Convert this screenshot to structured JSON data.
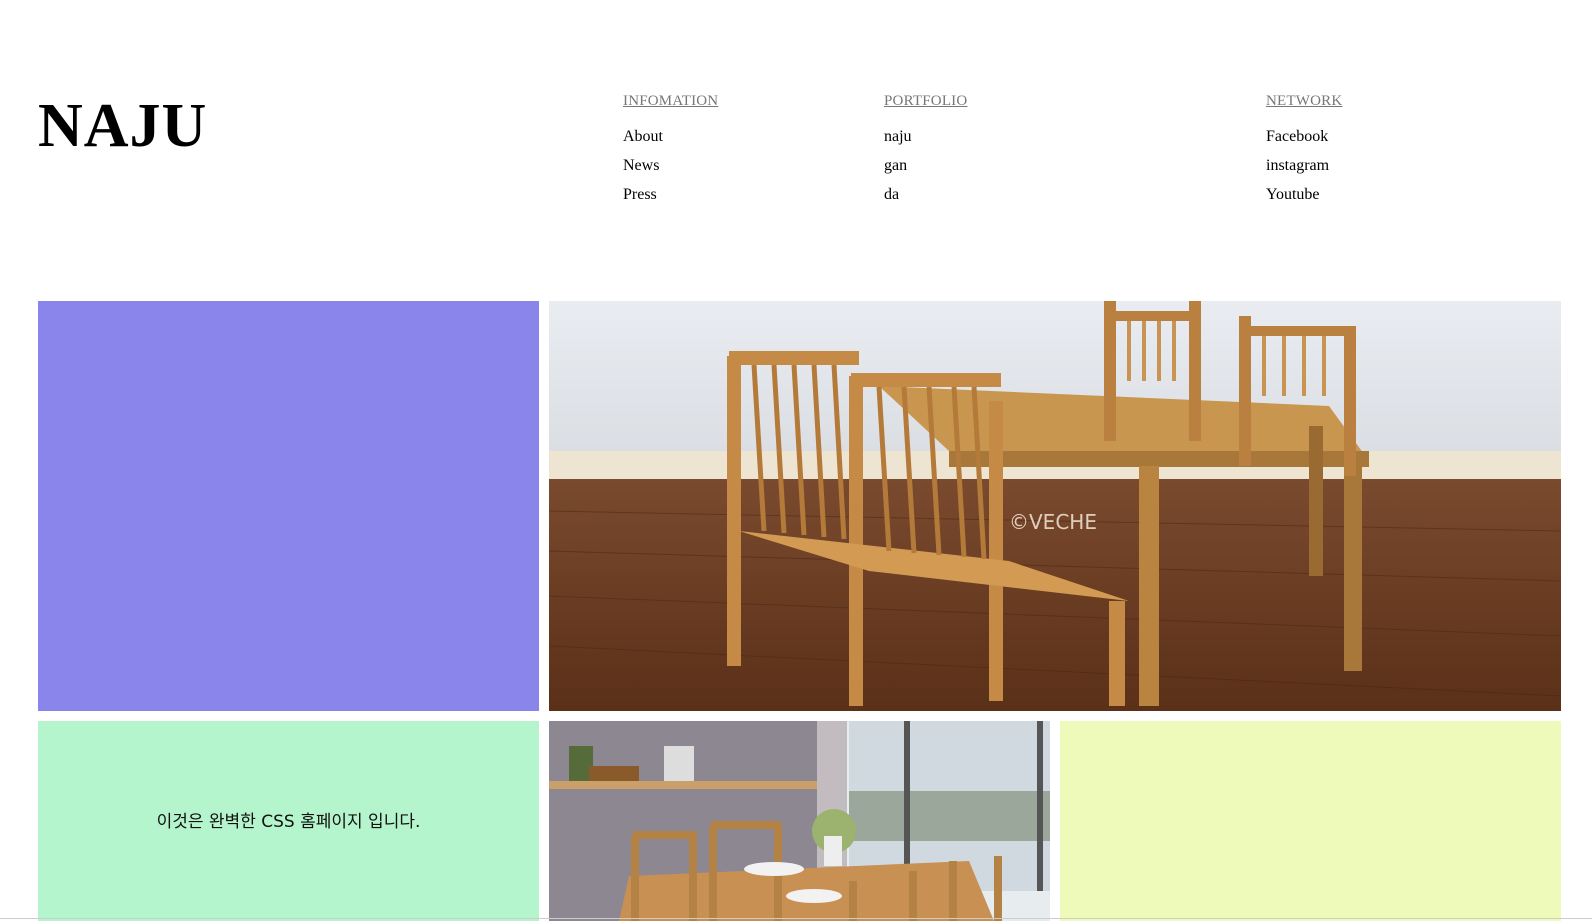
{
  "brand": {
    "logo": "NAJU"
  },
  "nav": {
    "columns": [
      {
        "heading": "INFOMATION",
        "links": [
          "About",
          "News",
          "Press"
        ]
      },
      {
        "heading": "PORTFOLIO",
        "links": [
          "naju",
          "gan",
          "da"
        ]
      },
      {
        "heading": "NETWORK",
        "links": [
          "Facebook",
          "instagram",
          "Youtube"
        ]
      }
    ]
  },
  "tiles": {
    "green_text": "이것은 완벽한 CSS 홈페이지 입니다.",
    "photo1_watermark": "©VECHE",
    "colors": {
      "purple": "#8a85eb",
      "green": "#b5f5cd",
      "yellow": "#eefab9"
    }
  }
}
